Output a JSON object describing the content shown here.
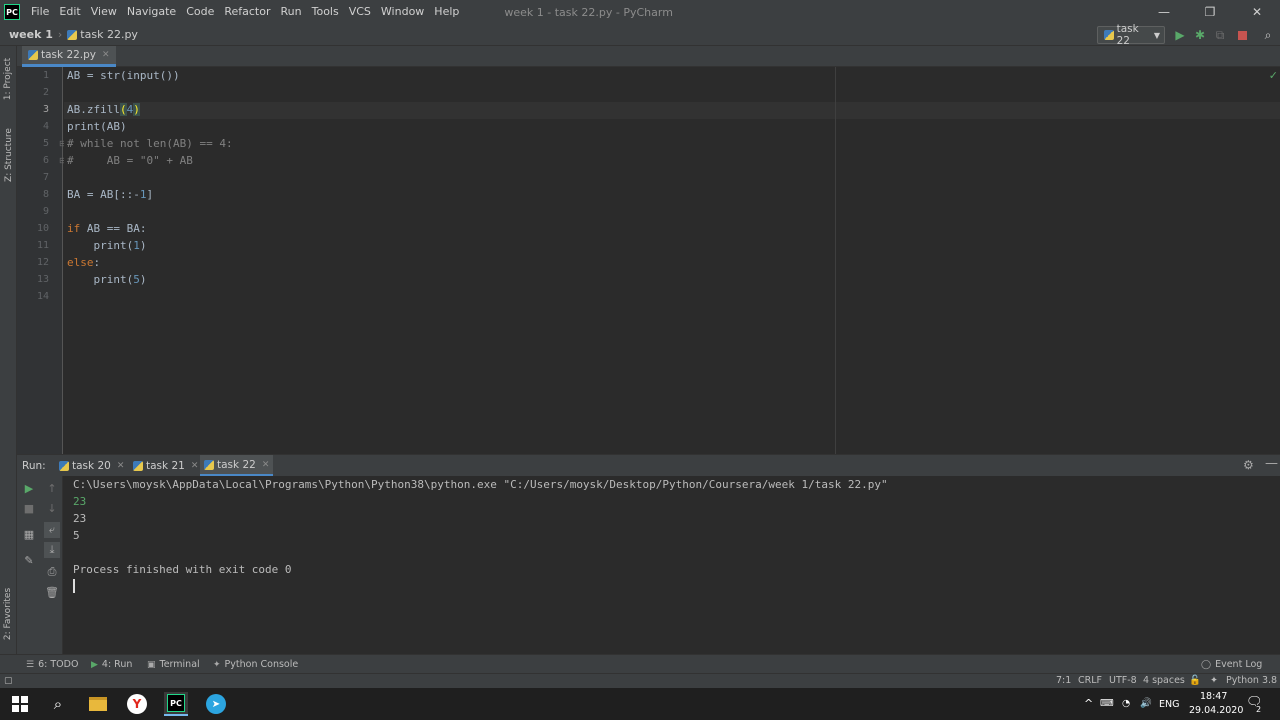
{
  "menu": {
    "app_logo": "PC",
    "items": [
      "File",
      "Edit",
      "View",
      "Navigate",
      "Code",
      "Refactor",
      "Run",
      "Tools",
      "VCS",
      "Window",
      "Help"
    ],
    "window_title": "week 1 - task 22.py - PyCharm"
  },
  "window_controls": {
    "minimize": "—",
    "restore": "❐",
    "close": "✕"
  },
  "navbar": {
    "project": "week 1",
    "file": "task 22.py",
    "run_config": "task 22"
  },
  "left_strip": {
    "project_tab": "1: Project",
    "structure_tab": "Z: Structure",
    "favorites_tab": "2: Favorites"
  },
  "editor": {
    "tab_label": "task 22.py",
    "line_numbers": [
      "1",
      "2",
      "3",
      "4",
      "5",
      "6",
      "7",
      "8",
      "9",
      "10",
      "11",
      "12",
      "13",
      "14"
    ]
  },
  "run_panel": {
    "label": "Run:",
    "tabs": [
      "task 20",
      "task 21",
      "task 22"
    ],
    "console": {
      "command": "C:\\Users\\moysk\\AppData\\Local\\Programs\\Python\\Python38\\python.exe \"C:/Users/moysk/Desktop/Python/Coursera/week 1/task 22.py\"",
      "input_echo": "23",
      "out1": "23",
      "out2": "5",
      "finished": "Process finished with exit code 0"
    }
  },
  "bottom_tabs": {
    "todo": "6: TODO",
    "run": "4: Run",
    "terminal": "Terminal",
    "python_console": "Python Console",
    "event_log": "Event Log"
  },
  "status": {
    "position": "7:1",
    "line_sep": "CRLF",
    "encoding": "UTF-8",
    "indent": "4 spaces",
    "interpreter": "Python 3.8"
  },
  "taskbar": {
    "lang": "ENG",
    "time": "18:47",
    "date": "29.04.2020",
    "notif_count": "2"
  },
  "colors": {
    "accent": "#4a88c7",
    "run_green": "#59a869",
    "stop_red": "#c75450",
    "keyword": "#cc7832",
    "number": "#6897bb",
    "comment": "#808080"
  }
}
